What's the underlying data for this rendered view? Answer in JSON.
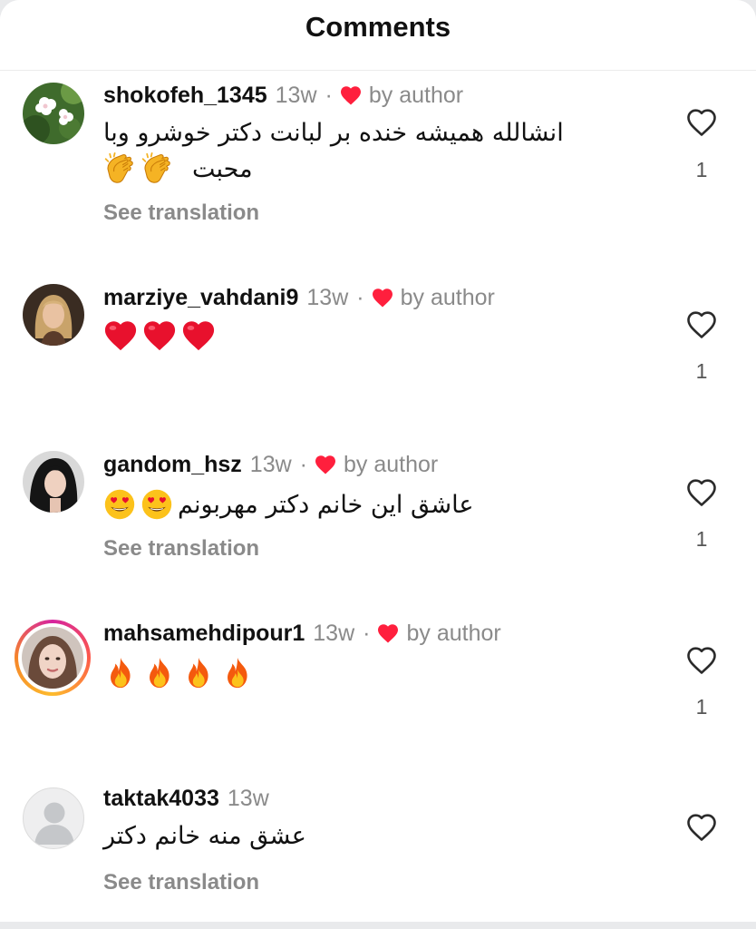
{
  "header": {
    "title": "Comments"
  },
  "colors": {
    "author_heart": "#ff1f3d",
    "secondary_text": "#8a8a8a"
  },
  "comments": [
    {
      "username": "shokofeh_1345",
      "time": "13w",
      "separator": "·",
      "author_badge": "by author",
      "text_line1": "انشالله همیشه خنده بر لبانت دکتر خوشرو وبا",
      "text_line2": "محبت",
      "emojis": [
        "clapping-hands",
        "clapping-hands"
      ],
      "see_translation": "See translation",
      "likes": "1"
    },
    {
      "username": "marziye_vahdani9",
      "time": "13w",
      "separator": "·",
      "author_badge": "by author",
      "emojis": [
        "red-heart",
        "red-heart",
        "red-heart"
      ],
      "likes": "1"
    },
    {
      "username": "gandom_hsz",
      "time": "13w",
      "separator": "·",
      "author_badge": "by author",
      "text_line1": "عاشق این خانم دکتر مهربونم",
      "emojis": [
        "heart-eyes",
        "heart-eyes"
      ],
      "see_translation": "See translation",
      "likes": "1"
    },
    {
      "username": "mahsamehdipour1",
      "time": "13w",
      "separator": "·",
      "author_badge": "by author",
      "emojis": [
        "fire",
        "fire",
        "fire",
        "fire"
      ],
      "likes": "1"
    },
    {
      "username": "taktak4033",
      "time": "13w",
      "text_line1": "عشق منه خانم دکتر",
      "see_translation": "See translation"
    }
  ]
}
